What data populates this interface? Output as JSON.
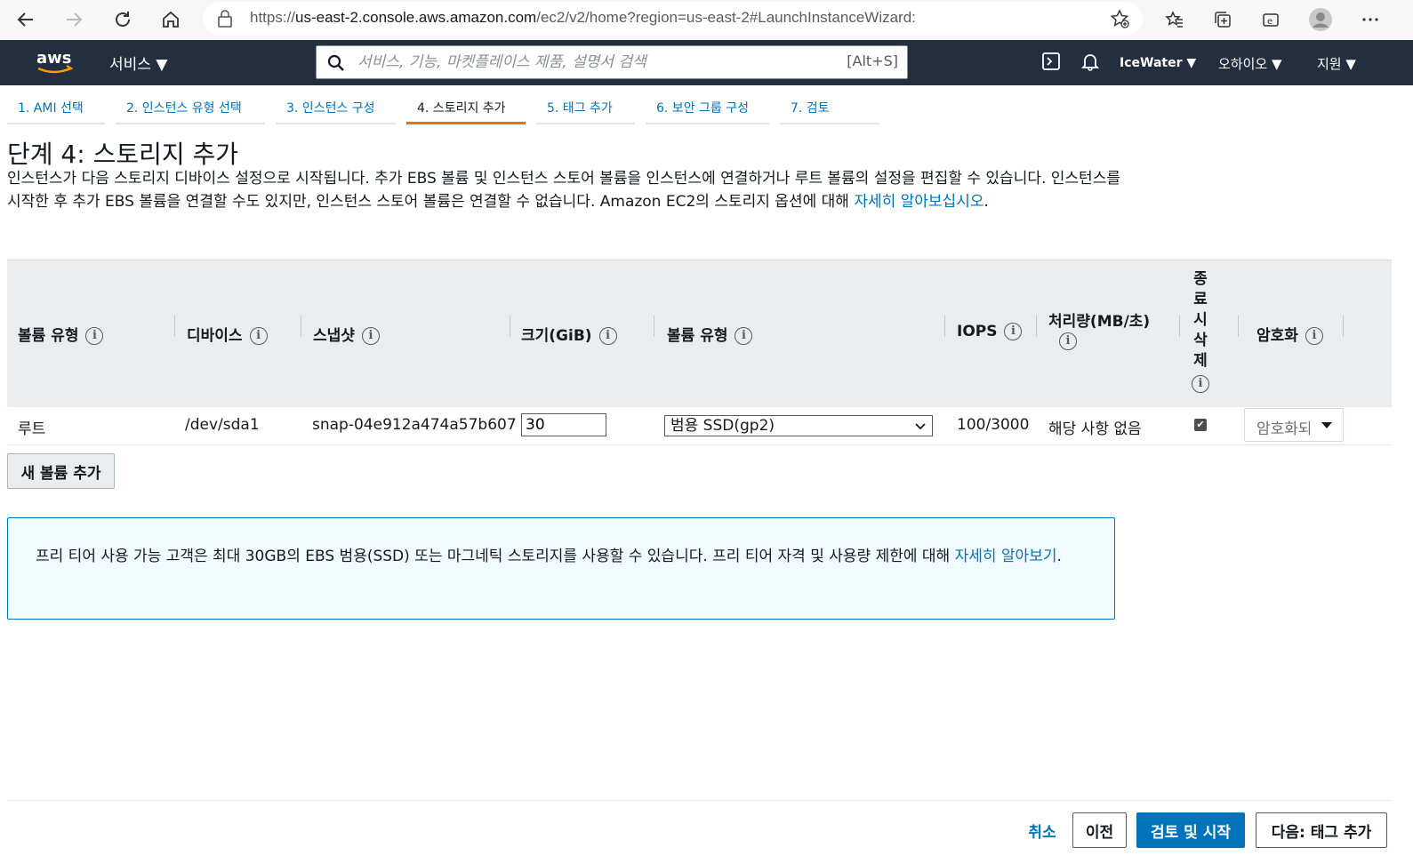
{
  "browser": {
    "url_scheme": "https://",
    "url_host": "us-east-2.console.aws.amazon.com",
    "url_path": "/ec2/v2/home?region=us-east-2#LaunchInstanceWizard:"
  },
  "nav": {
    "services": "서비스",
    "search_placeholder": "서비스, 기능, 마켓플레이스 제품, 설명서 검색",
    "search_shortcut": "[Alt+S]",
    "account": "IceWater",
    "region": "오하이오",
    "support": "지원"
  },
  "tabs": [
    {
      "label": "1. AMI 선택"
    },
    {
      "label": "2. 인스턴스 유형 선택"
    },
    {
      "label": "3. 인스턴스 구성"
    },
    {
      "label": "4. 스토리지 추가"
    },
    {
      "label": "5. 태그 추가"
    },
    {
      "label": "6. 보안 그룹 구성"
    },
    {
      "label": "7. 검토"
    }
  ],
  "page": {
    "title": "단계 4: 스토리지 추가",
    "description": "인스턴스가 다음 스토리지 디바이스 설정으로 시작됩니다. 추가 EBS 볼륨 및 인스턴스 스토어 볼륨을 인스턴스에 연결하거나 루트 볼륨의 설정을 편집할 수 있습니다. 인스턴스를 시작한 후 추가 EBS 볼륨을 연결할 수도 있지만, 인스턴스 스토어 볼륨은 연결할 수 없습니다. Amazon EC2의 스토리지 옵션에 대해 ",
    "learn_more": "자세히 알아보십시오",
    "period": "."
  },
  "table": {
    "headers": {
      "volume_type": "볼륨 유형",
      "device": "디바이스",
      "snapshot": "스냅샷",
      "size": "크기(GiB)",
      "volume_kind": "볼륨 유형",
      "iops": "IOPS",
      "throughput": "처리량(MB/초)",
      "delete_on_termination": "종료 시 삭제",
      "encryption": "암호화"
    },
    "row": {
      "volume_type": "루트",
      "device": "/dev/sda1",
      "snapshot": "snap-04e912a474a57b607",
      "size": "30",
      "volume_kind": "범용 SSD(gp2)",
      "iops": "100/3000",
      "throughput": "해당 사항 없음",
      "delete_on_termination": true,
      "encryption": "암호화되지"
    }
  },
  "add_volume": "새 볼륨 추가",
  "notice": {
    "text": "프리 티어 사용 가능 고객은 최대 30GB의 EBS 범용(SSD) 또는 마그네틱 스토리지를 사용할 수 있습니다. 프리 티어 자격 및 사용량 제한에 대해 ",
    "link": "자세히 알아보기",
    "period": "."
  },
  "footer": {
    "cancel": "취소",
    "previous": "이전",
    "review_launch": "검토 및 시작",
    "next": "다음: 태그 추가"
  },
  "colors": {
    "nav_bg": "#232f3e",
    "link": "#0073bb",
    "primary": "#0073bb",
    "active_tab": "#ec7211"
  }
}
